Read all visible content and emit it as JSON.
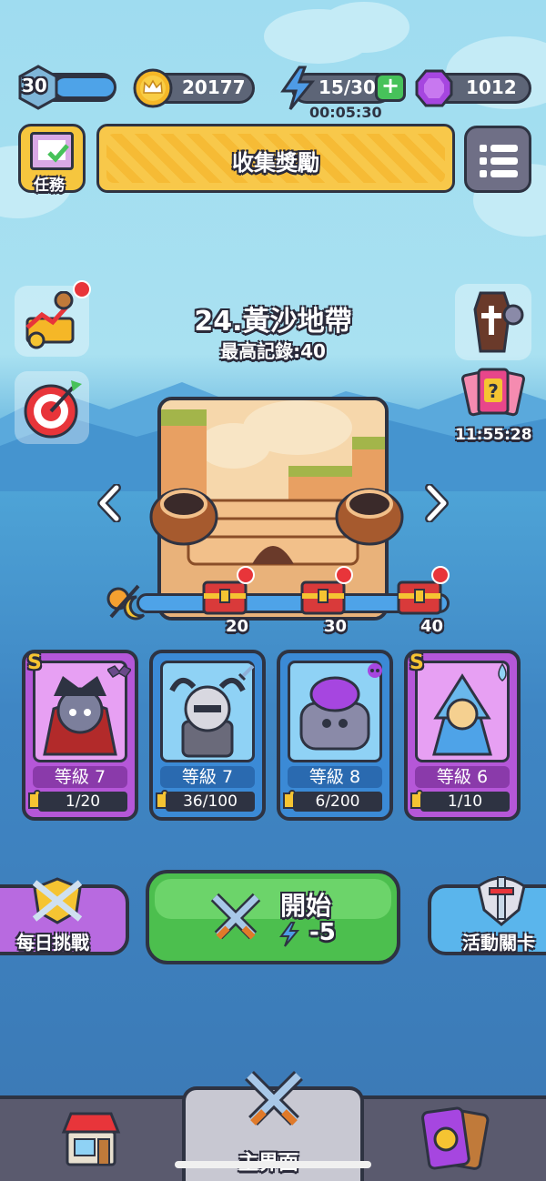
{
  "player": {
    "level": "30"
  },
  "resources": {
    "gold": "20177",
    "energy": "15/30",
    "energy_timer": "00:05:30",
    "gems": "1012"
  },
  "top_actions": {
    "quest_label": "任務",
    "collect_reward_label": "收集獎勵"
  },
  "stage": {
    "title": "24.黃沙地帶",
    "best_record": "最高記錄:40"
  },
  "side": {
    "event_timer": "11:55:28"
  },
  "milestones": [
    {
      "label": "20"
    },
    {
      "label": "30"
    },
    {
      "label": "40"
    }
  ],
  "heroes": [
    {
      "name": "vampire",
      "level": "等級 7",
      "progress": "1/20",
      "rarity": "S",
      "color": "#c463e6"
    },
    {
      "name": "horned-knight",
      "level": "等級 7",
      "progress": "36/100",
      "rarity": "",
      "color": "#4f9ee0"
    },
    {
      "name": "purple-golem",
      "level": "等級 8",
      "progress": "6/200",
      "rarity": "",
      "color": "#4f9ee0"
    },
    {
      "name": "water-mage",
      "level": "等級 6",
      "progress": "1/10",
      "rarity": "S",
      "color": "#c463e6"
    }
  ],
  "buttons": {
    "daily_challenge": "每日挑戰",
    "start": "開始",
    "start_cost": "-5",
    "event_stage": "活動關卡"
  },
  "bottom_nav": {
    "main_label": "主界面"
  }
}
